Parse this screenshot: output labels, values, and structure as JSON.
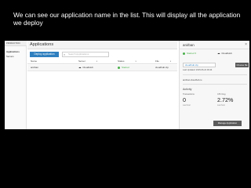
{
  "slide": {
    "caption": "We can see our application name in the list. This will display all the application we deploy"
  },
  "sidebar": {
    "environment": "PRODUCTION",
    "items": [
      {
        "label": "Applications",
        "active": true
      },
      {
        "label": "Servers",
        "active": false
      }
    ]
  },
  "main": {
    "title": "Applications",
    "deploy_button": "Deploy application",
    "search_placeholder": "Search Applications",
    "columns": [
      "Name",
      "Server",
      "Status",
      "File"
    ],
    "rows": [
      {
        "name": "anirban",
        "server": "CloudHub",
        "status": "Started",
        "file": "cloudhub.zip"
      }
    ]
  },
  "detail": {
    "title": "anirban",
    "status": "Started",
    "server": "CloudHub",
    "file_input": "cloudhub.zip",
    "choose_file_button": "Choose file",
    "last_updated": "Last Updated: 2015-06-22 09:44",
    "url": "anirban.cloudhub.io",
    "activity_label": "Activity",
    "transactions": {
      "label": "Transactions",
      "value": "0",
      "sub": "Last hour"
    },
    "cpu": {
      "label": "CPU Avg",
      "value": "2.72%",
      "sub": "Last hour"
    },
    "manage_button": "Manage Application"
  },
  "icons": {
    "search": "search-icon",
    "cloud": "cloud-icon",
    "close": "close-icon",
    "status": "status-dot-icon"
  },
  "colors": {
    "accent": "#2f7fbf",
    "started": "#49b04a",
    "dark_button": "#5b5b5b"
  }
}
